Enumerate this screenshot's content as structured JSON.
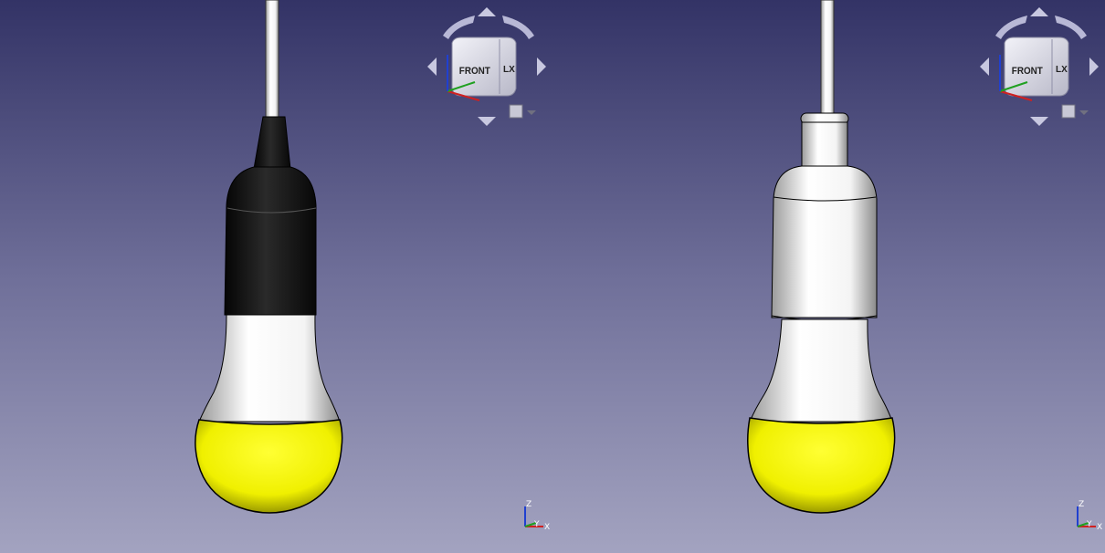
{
  "viewports": [
    {
      "id": "left",
      "model": {
        "socket_color": "#111111",
        "neck_color": "#ffffff",
        "globe_color": "#f2f200",
        "cable_color": "#ffffff"
      },
      "navcube": {
        "front_label": "FRONT",
        "side_label": "LX"
      },
      "axis": {
        "z": "Z",
        "y": "Y",
        "x": "X"
      }
    },
    {
      "id": "right",
      "model": {
        "socket_color": "#f4f4f4",
        "neck_color": "#ffffff",
        "globe_color": "#f2f200",
        "cable_color": "#ffffff"
      },
      "navcube": {
        "front_label": "FRONT",
        "side_label": "LX"
      },
      "axis": {
        "z": "Z",
        "y": "Y",
        "x": "X"
      }
    }
  ],
  "colors": {
    "background_top": "#333366",
    "background_bottom": "#a3a3c0",
    "axis_x": "#d02020",
    "axis_y": "#20a020",
    "axis_z": "#2040d0"
  }
}
